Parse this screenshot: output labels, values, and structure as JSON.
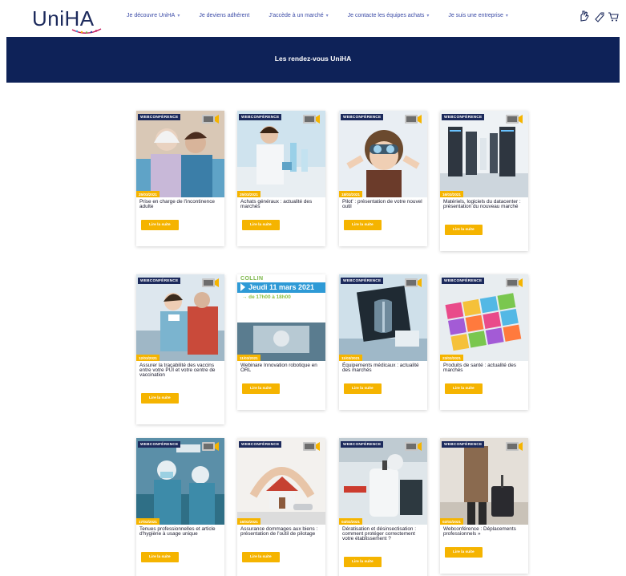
{
  "header": {
    "logo_text": "UniHA",
    "nav": [
      {
        "label": "Je découvre UniHA",
        "dropdown": true
      },
      {
        "label": "Je deviens adhérent",
        "dropdown": false
      },
      {
        "label": "J'accède à un marché",
        "dropdown": true
      },
      {
        "label": "Je contacte les équipes achats",
        "dropdown": true
      },
      {
        "label": "Je suis une entreprise",
        "dropdown": true
      }
    ],
    "icons": [
      "hand-icon",
      "tag-icon",
      "cart-icon"
    ]
  },
  "banner": {
    "title": "Les rendez-vous UniHA"
  },
  "cards": [
    {
      "tag": "WEBCONFÉRENCE",
      "date": "25/03/2021",
      "title": "Prise en charge de l'incontinence adulte",
      "button": "Lire la suite",
      "img": "elderly"
    },
    {
      "tag": "WEBCONFÉRENCE",
      "date": "25/03/2021",
      "title": "Achats généraux : actualité des marchés",
      "button": "Lire la suite",
      "img": "lab"
    },
    {
      "tag": "WEBCONFÉRENCE",
      "date": "18/03/2021",
      "title": "Pilot' : présentation de votre nouvel outil",
      "button": "Lire la suite",
      "img": "pilot"
    },
    {
      "tag": "WEBCONFÉRENCE",
      "date": "16/03/2021",
      "title": "Matériels, logiciels du datacenter : présentation du nouveau marché",
      "button": "Lire la suite",
      "img": "datacenter"
    },
    {
      "tag": "WEBCONFÉRENCE",
      "date": "12/03/2021",
      "title": "Assurer la traçabilité des vaccins entre votre PUI et votre centre de vaccination",
      "button": "Lire la suite",
      "img": "vaccine"
    },
    {
      "tag": "",
      "date": "11/03/2021",
      "title": "Webinare Innovation robotique en ORL",
      "button": "Lire la suite",
      "img": "colwin",
      "colwin_logo": "COLLIN",
      "colwin_date": "Jeudi 11 mars 2021",
      "colwin_time": "→ de 17h00 à 18h00"
    },
    {
      "tag": "WEBCONFÉRENCE",
      "date": "11/03/2021",
      "title": "Équipements médicaux : actualité des marchés",
      "button": "Lire la suite",
      "img": "xray"
    },
    {
      "tag": "WEBCONFÉRENCE",
      "date": "23/02/2021",
      "title": "Produits de santé : actualité des marchés",
      "button": "Lire la suite",
      "img": "pills"
    },
    {
      "tag": "WEBCONFÉRENCE",
      "date": "17/02/2021",
      "title": "Tenues professionnelles et article d'hygiène à usage unique",
      "button": "Lire la suite",
      "img": "surgery"
    },
    {
      "tag": "WEBCONFÉRENCE",
      "date": "16/02/2021",
      "title": "Assurance dommages aux biens : présentation de l'outil de pilotage",
      "button": "Lire la suite",
      "img": "house"
    },
    {
      "tag": "WEBCONFÉRENCE",
      "date": "04/02/2021",
      "title": "Dératisation et désinsectisation : comment protéger correctement votre établissement ?",
      "button": "Lire la suite",
      "img": "spray"
    },
    {
      "tag": "WEBCONFÉRENCE",
      "date": "02/02/2021",
      "title": "Webconférence : Déplacements professionnels »",
      "button": "Lire la suite",
      "img": "travel"
    }
  ],
  "colors": {
    "navy": "#0e2258",
    "accent": "#f5b400",
    "tag": "#1c2a5c"
  }
}
